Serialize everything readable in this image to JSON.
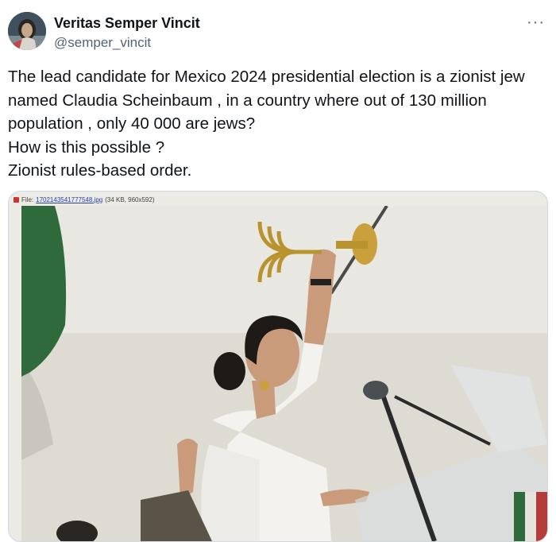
{
  "author": {
    "display_name": "Veritas Semper Vincit",
    "handle": "@semper_vincit"
  },
  "menu": {
    "more_label": "···"
  },
  "tweet": {
    "lines": [
      "The lead candidate for Mexico 2024 presidential election is a zionist jew",
      "named Claudia Scheinbaum , in a country where out of 130 million",
      "population , only 40 000 are jews?",
      "How is this possible ?",
      "Zionist rules-based order."
    ]
  },
  "media": {
    "file_label": "File:",
    "file_name": "1702143541777548.jpg",
    "file_meta": "(34 KB, 960x592)"
  },
  "colors": {
    "text": "#0f1419",
    "secondary": "#536471",
    "border": "#cfd9de",
    "link": "#2244aa"
  },
  "icons": [
    "more-options-icon",
    "file-icon",
    "avatar-image"
  ]
}
